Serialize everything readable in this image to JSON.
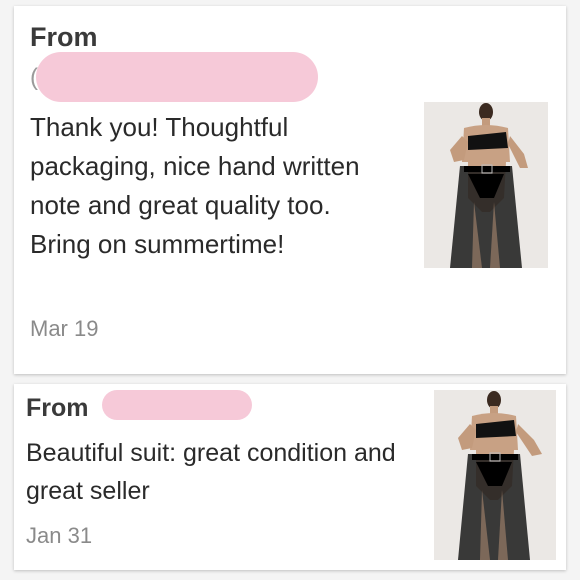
{
  "reviews": [
    {
      "from_label": "From",
      "name_initial": "(",
      "message": "Thank you! Thoughtful packaging, nice hand written note and great quality too. Bring on summertime!",
      "date": "Mar 19"
    },
    {
      "from_label": "From",
      "message": "Beautiful suit: great condition and great seller",
      "date": "Jan 31"
    }
  ],
  "colors": {
    "redaction": "#f6c9d8",
    "card_background": "#ffffff",
    "page_background": "#f4f4f4",
    "date_text": "#8a8a8a"
  },
  "icons": [
    "product-photo"
  ]
}
